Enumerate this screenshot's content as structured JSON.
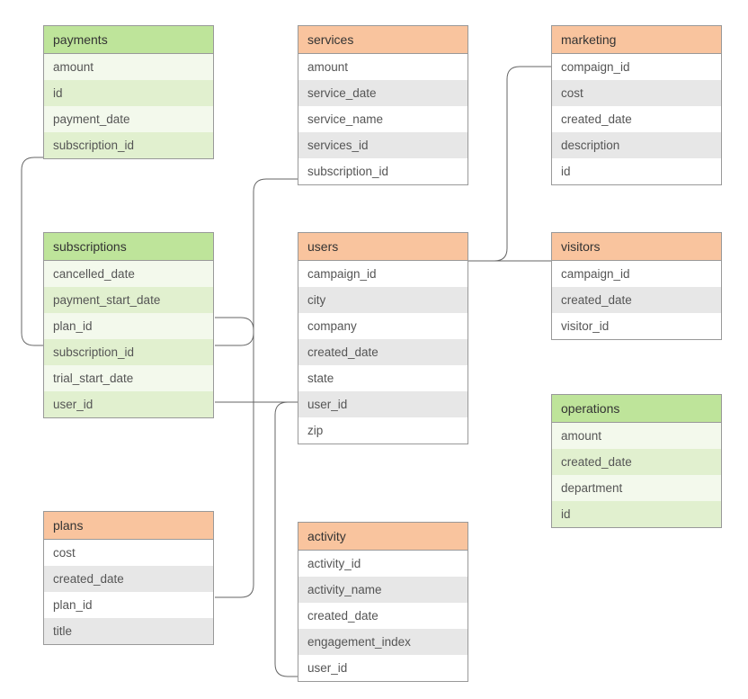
{
  "tables": {
    "payments": {
      "title": "payments",
      "color": "green",
      "fields": [
        "amount",
        "id",
        "payment_date",
        "subscription_id"
      ]
    },
    "subscriptions": {
      "title": "subscriptions",
      "color": "green",
      "fields": [
        "cancelled_date",
        "payment_start_date",
        "plan_id",
        "subscription_id",
        "trial_start_date",
        "user_id"
      ]
    },
    "plans": {
      "title": "plans",
      "color": "orange",
      "fields": [
        "cost",
        "created_date",
        "plan_id",
        "title"
      ]
    },
    "services": {
      "title": "services",
      "color": "orange",
      "fields": [
        "amount",
        "service_date",
        "service_name",
        "services_id",
        "subscription_id"
      ]
    },
    "users": {
      "title": "users",
      "color": "orange",
      "fields": [
        "campaign_id",
        "city",
        "company",
        "created_date",
        "state",
        "user_id",
        "zip"
      ]
    },
    "activity": {
      "title": "activity",
      "color": "orange",
      "fields": [
        "activity_id",
        "activity_name",
        "created_date",
        "engagement_index",
        "user_id"
      ]
    },
    "marketing": {
      "title": "marketing",
      "color": "orange",
      "fields": [
        "compaign_id",
        "cost",
        "created_date",
        "description",
        "id"
      ]
    },
    "visitors": {
      "title": "visitors",
      "color": "orange",
      "fields": [
        "campaign_id",
        "created_date",
        "visitor_id"
      ]
    },
    "operations": {
      "title": "operations",
      "color": "green",
      "fields": [
        "amount",
        "created_date",
        "department",
        "id"
      ]
    }
  },
  "relationships": [
    {
      "from": "payments.subscription_id",
      "to": "subscriptions.subscription_id"
    },
    {
      "from": "subscriptions.subscription_id",
      "to": "services.subscription_id"
    },
    {
      "from": "subscriptions.plan_id",
      "to": "plans.plan_id"
    },
    {
      "from": "subscriptions.user_id",
      "to": "users.user_id"
    },
    {
      "from": "users.user_id",
      "to": "activity.user_id"
    },
    {
      "from": "users.campaign_id",
      "to": "marketing.compaign_id"
    },
    {
      "from": "users.campaign_id",
      "to": "visitors.campaign_id"
    }
  ]
}
